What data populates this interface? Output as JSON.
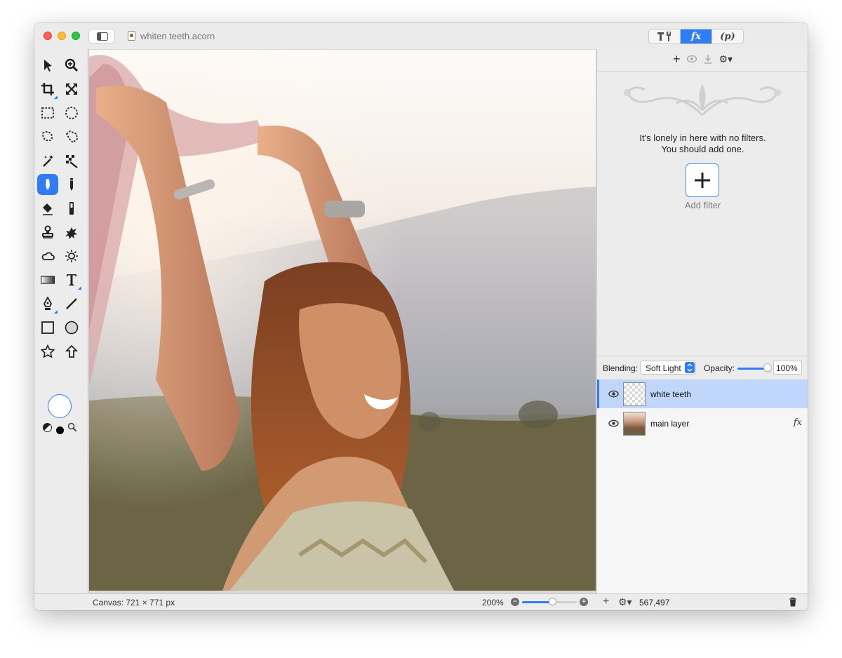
{
  "window": {
    "title": "whiten teeth.acorn"
  },
  "inspector_tabs": [
    {
      "label": "",
      "icon": "tools-icon",
      "active": false
    },
    {
      "label": "fx",
      "icon": "filters-icon",
      "active": true
    },
    {
      "label": "(p)",
      "icon": "properties-icon",
      "active": false
    }
  ],
  "tools": [
    "pointer-tool",
    "zoom-tool",
    "crop-tool",
    "transform-tool",
    "rect-select-tool",
    "ellipse-select-tool",
    "lasso-tool",
    "polygon-lasso-tool",
    "magic-wand-tool",
    "color-wand-tool",
    "brush-tool",
    "pencil-tool",
    "paint-bucket-tool",
    "eraser-tool",
    "clone-stamp-tool",
    "smudge-tool",
    "burn-tool",
    "dodge-tool",
    "gradient-tool",
    "text-tool",
    "pen-tool",
    "line-tool",
    "rectangle-tool",
    "ellipse-tool",
    "star-tool",
    "arrow-tool"
  ],
  "active_tool": "brush-tool",
  "colors": {
    "accent": "#2f7cf6",
    "fill_well": "#ffffff",
    "foreground": "#000000"
  },
  "filters": {
    "empty_message_line1": "It's lonely in here with no filters.",
    "empty_message_line2": "You should add one.",
    "add_label": "Add filter"
  },
  "blending": {
    "label": "Blending:",
    "mode": "Soft Light",
    "opacity_label": "Opacity:",
    "opacity_value": "100%",
    "opacity_fraction": 1.0
  },
  "layers": [
    {
      "name": "white teeth",
      "selected": true,
      "has_fx": false,
      "thumb": "transparent"
    },
    {
      "name": "main layer",
      "selected": false,
      "has_fx": true,
      "fx_label": "fx",
      "thumb": "photo"
    }
  ],
  "status": {
    "canvas_size": "Canvas: 721 × 771 px",
    "zoom": "200%",
    "zoom_fraction": 0.55,
    "count": "567,497"
  }
}
